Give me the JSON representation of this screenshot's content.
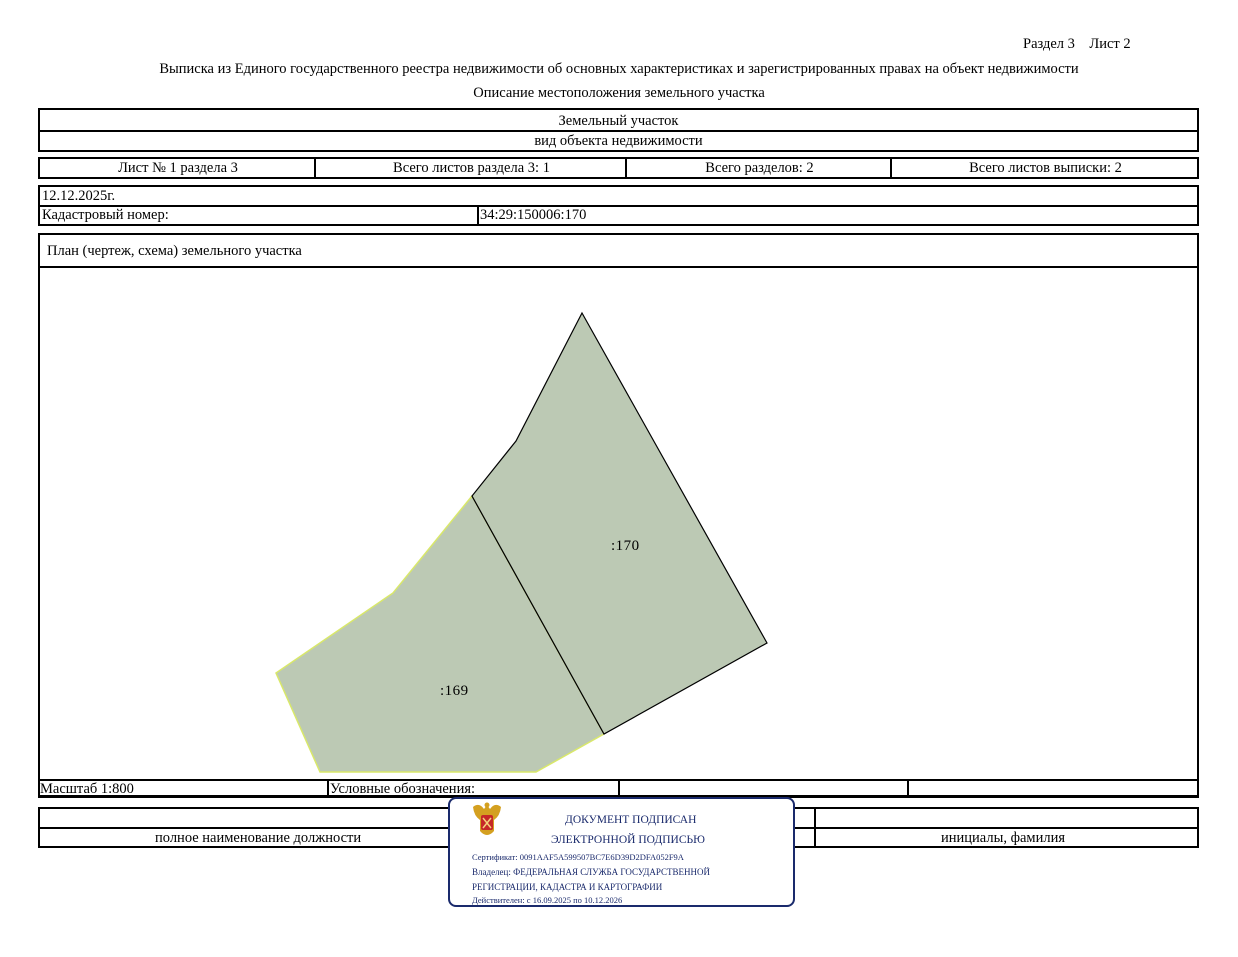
{
  "header": {
    "section_sheet": "Раздел 3    Лист 2",
    "title": "Выписка из Единого государственного реестра недвижимости об основных характеристиках и зарегистрированных правах на объект недвижимости",
    "subtitle": "Описание местоположения земельного участка"
  },
  "object": {
    "type": "Земельный участок",
    "type_caption": "вид объекта недвижимости"
  },
  "sheets": {
    "sheet_num": "Лист № 1 раздела 3",
    "total_sheets_section": "Всего листов раздела 3: 1",
    "total_sections": "Всего разделов: 2",
    "total_sheets_extract": "Всего листов выписки: 2"
  },
  "info": {
    "date": "12.12.2025г.",
    "cadastral_label": "Кадастровый номер:",
    "cadastral_value": "34:29:150006:170"
  },
  "plan": {
    "title": "План (чертеж, схема) земельного участка",
    "parcel_main_label": ":170",
    "parcel_neighbor_label": ":169",
    "colors": {
      "parcel_fill": "#bcc9b4",
      "parcel_stroke": "#000000",
      "neighbor_highlight": "#d9e86a"
    }
  },
  "footer": {
    "scale": "Масштаб 1:800",
    "legend_label": "Условные обозначения:",
    "position_caption": "полное наименование должности",
    "name_caption": "инициалы, фамилия"
  },
  "stamp": {
    "line1": "ДОКУМЕНТ ПОДПИСАН",
    "line2": "ЭЛЕКТРОННОЙ ПОДПИСЬЮ",
    "certificate": "Сертификат: 0091AAF5A599507BC7E6D39D2DFA052F9A",
    "owner_1": "Владелец: ФЕДЕРАЛЬНАЯ СЛУЖБА ГОСУДАРСТВЕННОЙ",
    "owner_2": "РЕГИСТРАЦИИ, КАДАСТРА И КАРТОГРАФИИ",
    "valid": "Действителен: с 16.09.2025 по 10.12.2026",
    "emblem_icon": "coat-of-arms-icon",
    "color": "#1a2a6c"
  }
}
